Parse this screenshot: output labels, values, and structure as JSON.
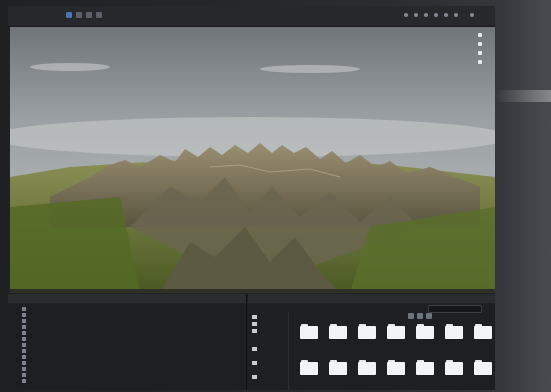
{
  "toolbar": {
    "tabs": [
      "",
      ""
    ],
    "buttons": [
      "",
      "",
      "",
      ""
    ]
  },
  "right_bezel": {
    "hint": ""
  },
  "hierarchy": {
    "title": "",
    "rows": [
      "",
      "",
      "",
      "",
      "",
      "",
      "",
      "",
      "",
      "",
      "",
      "",
      ""
    ]
  },
  "project": {
    "title": "",
    "tree": [
      "",
      "",
      "",
      "",
      "",
      ""
    ],
    "folders": [
      {
        "label": ""
      },
      {
        "label": ""
      },
      {
        "label": ""
      },
      {
        "label": ""
      },
      {
        "label": ""
      },
      {
        "label": ""
      },
      {
        "label": ""
      },
      {
        "label": ""
      },
      {
        "label": ""
      },
      {
        "label": ""
      },
      {
        "label": ""
      },
      {
        "label": ""
      },
      {
        "label": ""
      },
      {
        "label": ""
      }
    ]
  },
  "colors": {
    "sky_top": "#7f8488",
    "sky_bottom": "#b7bcbf",
    "mountain": "#6d6a58",
    "forest": "#5b6e2e",
    "accent_blue": "#4b73b0"
  },
  "icons": {
    "scene_gizmo": "axis-gizmo-icon",
    "folder": "folder-icon",
    "search": "search-icon"
  }
}
